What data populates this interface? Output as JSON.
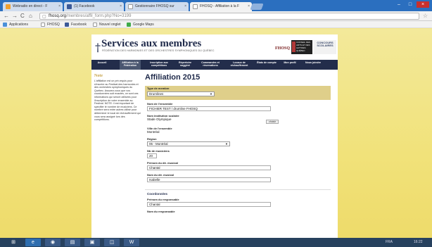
{
  "browser": {
    "tabs": [
      {
        "label": "Webradio en direct - F",
        "icon_color": "#f0a030",
        "active": false
      },
      {
        "label": "(1) Facebook",
        "icon_color": "#3b5998",
        "active": false
      },
      {
        "label": "Gestionnaire FHOSQ sur ",
        "icon_color": "#ffffff",
        "active": false
      },
      {
        "label": "FHOSQ - Affiliation à la F",
        "icon_color": "#ffffff",
        "active": true
      }
    ],
    "tab_close": "×",
    "window_controls": [
      "–",
      "□",
      "×"
    ],
    "url_host": "fhosq.org",
    "url_path": "/membres/affil_form.php?No=3199",
    "bookmarks": [
      {
        "label": "Applications",
        "icon_color": "#4a8fd8"
      },
      {
        "label": "FHOSQ",
        "icon_color": "#ffffff"
      },
      {
        "label": "Facebook",
        "icon_color": "#3b5998"
      },
      {
        "label": "Nouvel onglet",
        "icon_color": "#ffffff"
      },
      {
        "label": "Google Maps",
        "icon_color": "#3faa4a"
      }
    ]
  },
  "site": {
    "title": "Services aux membres",
    "subtitle": "FÉDÉRATION DES HARMONIES ET DES ORCHESTRES SYMPHONIQUES DU QUÉBEC",
    "fhosq_logo": "FHOSQ",
    "badge1": "CONSEIL DES ARTS ET DES LETTRES QUÉBEC",
    "badge2": "CONCOURS SCOLAIRES",
    "nav": [
      "Accueil",
      "Affiliation à la Fédération",
      "Inscription aux compétitions",
      "Répertoire suggéré",
      "Commandes et réservations",
      "Locaux de réchauffement",
      "États de compte",
      "Mon profil",
      "Nous joindre"
    ]
  },
  "sidebar": {
    "title": "Note",
    "text": "L'affiliation est un pré-requis pour s'inscrire au Festival des harmonies et des orchestres symphoniques du Québec. Assurez-vous que vos coordonnées soit exactes, ce sont ces informations qui seront utilisées pour l'inscription de votre ensemble au Festival. NOTE: il est important de spécifier le nombre de musiciens. Ce nombre sera entre autres utilisé pour déterminer le local de réchauffement qui vous sera assigné lors des compétitions."
  },
  "form": {
    "heading": "Affiliation 2015",
    "type_label": "Type de membre",
    "type_value": "Drumlines",
    "ensemble_label": "Nom de l'ensemble",
    "ensemble_value": "FICHIER TEST / drumline FHOSQ",
    "institution_label": "Nom institution scolaire",
    "institution_value": "Stade Olympique",
    "choose_button": "choisir",
    "city_label": "Ville de l'ensemble",
    "city_value": "Montréal",
    "region_label": "Région",
    "region_value": "06 - Montréal",
    "musicians_label": "Nb de musiciens",
    "musicians_value": "20",
    "director_first_label": "Prénom du dir. musical",
    "director_first_value": "Chantal",
    "director_last_label": "Nom du dir. musical",
    "director_last_value": "Isabelle",
    "coords_heading": "Coordonnées",
    "resp_first_label": "Prénom du responsable",
    "resp_first_value": "Chantal",
    "resp_last_label": "Nom du responsable"
  },
  "taskbar": {
    "clock": "16:22",
    "language": "FRA"
  }
}
